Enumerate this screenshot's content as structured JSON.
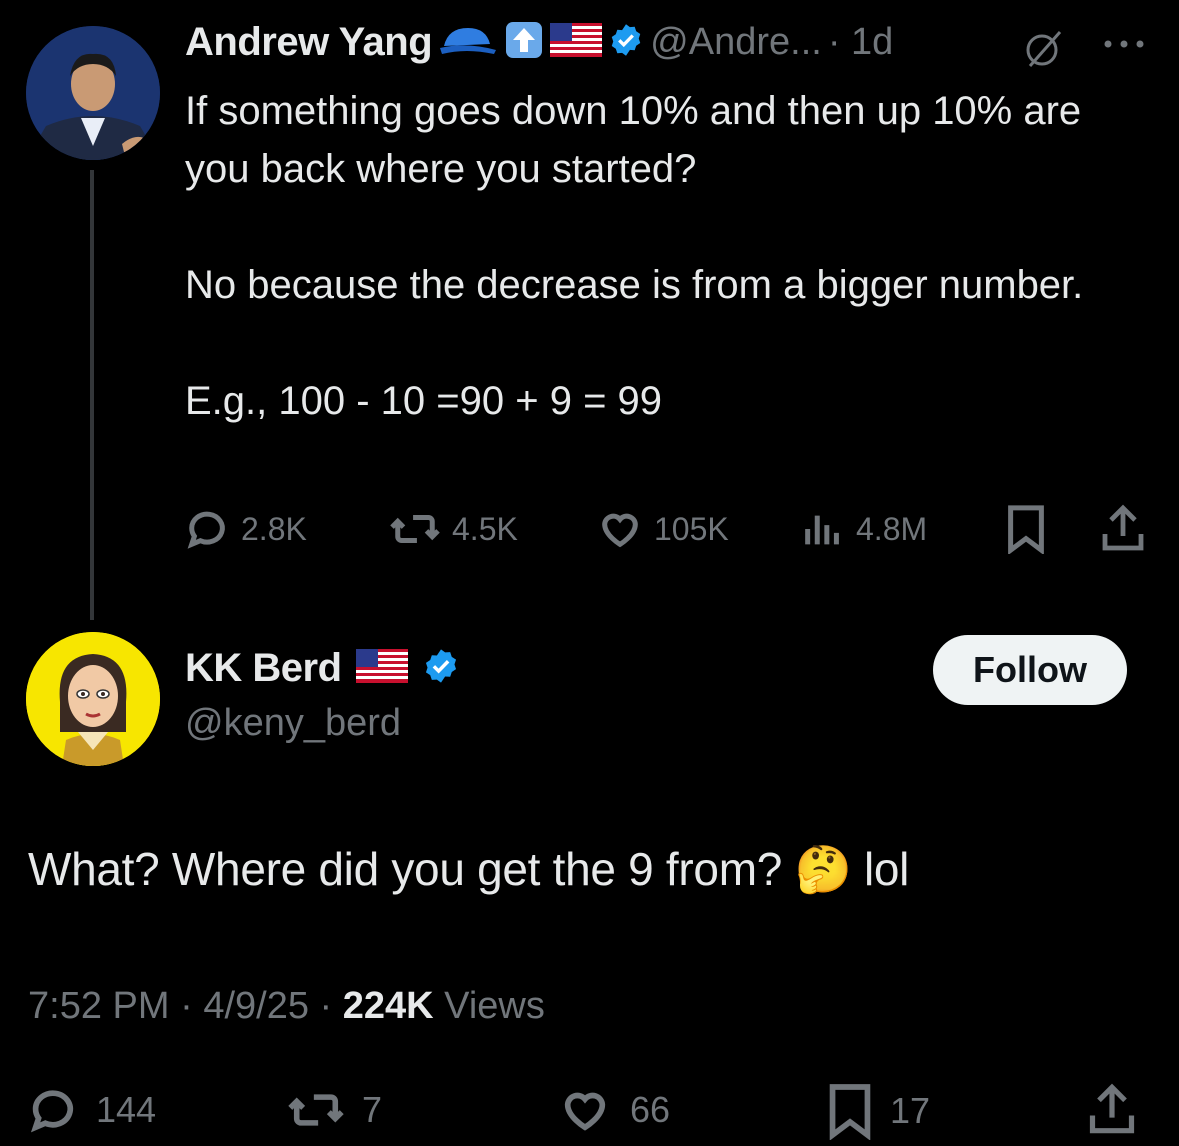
{
  "original_post": {
    "author_name": "Andrew Yang",
    "handle": "@Andre...",
    "time": "· 1d",
    "paragraphs": [
      "If something goes down 10% and then up 10% are you back where you started?",
      "No because the decrease is from a bigger number.",
      "E.g., 100 - 10 =90 + 9 = 99"
    ],
    "metrics": {
      "replies": "2.8K",
      "reposts": "4.5K",
      "likes": "105K",
      "views": "4.8M"
    }
  },
  "reply": {
    "author_name": "KK Berd",
    "handle": "@keny_berd",
    "follow_label": "Follow",
    "text_before_emoji": "What? Where did you get the 9 from?",
    "text_after_emoji": "lol",
    "emoji": "🤔",
    "time": "7:52 PM",
    "date": "4/9/25",
    "views_count": "224K",
    "views_label": "Views",
    "metrics": {
      "replies": "144",
      "reposts": "7",
      "likes": "66",
      "bookmarks": "17"
    }
  },
  "colors": {
    "background": "#000000",
    "text": "#e7e9ea",
    "secondary": "#71767b",
    "verified": "#1d9bf0"
  }
}
